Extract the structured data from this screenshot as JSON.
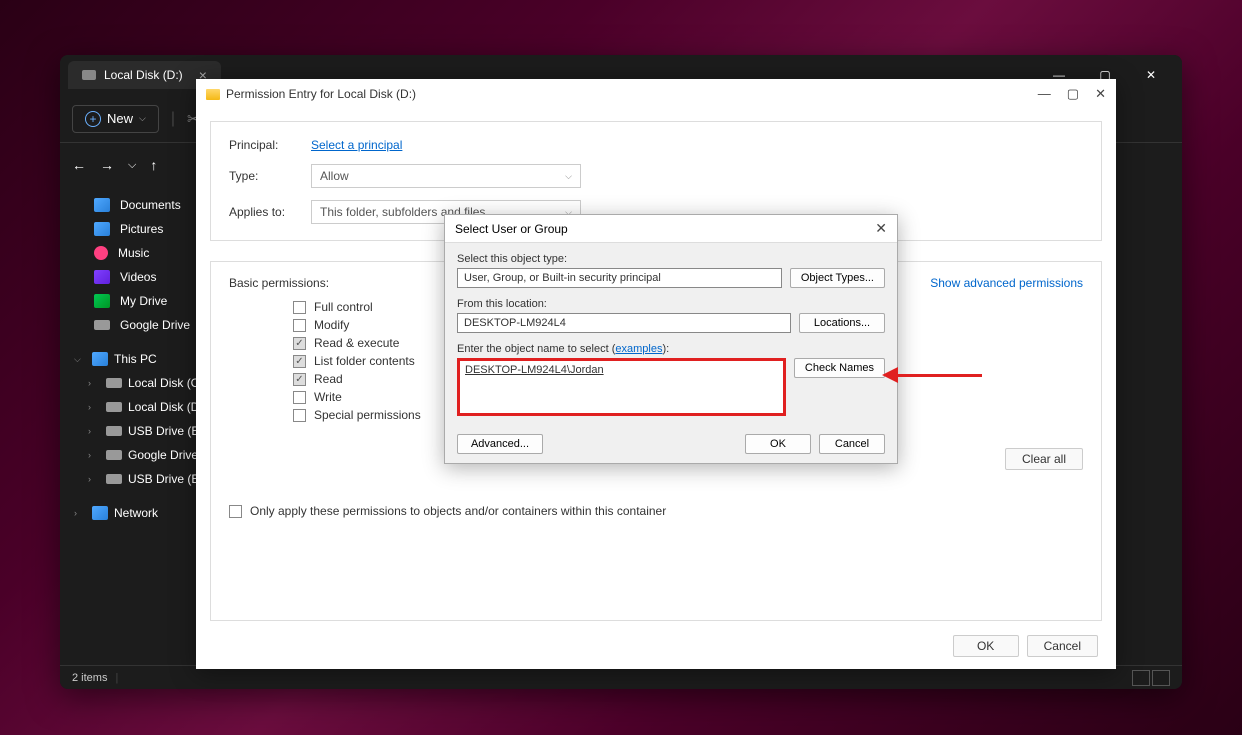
{
  "explorer": {
    "tab_title": "Local Disk (D:)",
    "new_btn": "New",
    "sidebar": {
      "quick": [
        {
          "label": "Documents",
          "icon": "ic-doc"
        },
        {
          "label": "Pictures",
          "icon": "ic-pic"
        },
        {
          "label": "Music",
          "icon": "ic-mus"
        },
        {
          "label": "Videos",
          "icon": "ic-vid"
        },
        {
          "label": "My Drive",
          "icon": "ic-drv"
        },
        {
          "label": "Google Drive",
          "icon": "ic-disk"
        }
      ],
      "this_pc": "This PC",
      "drives": [
        {
          "label": "Local Disk (C:)"
        },
        {
          "label": "Local Disk (D:)"
        },
        {
          "label": "USB Drive (E:)"
        },
        {
          "label": "Google Drive ("
        },
        {
          "label": "USB Drive (E:)"
        }
      ],
      "network": "Network"
    },
    "status": "2 items"
  },
  "perm": {
    "title": "Permission Entry for Local Disk (D:)",
    "principal_label": "Principal:",
    "principal_link": "Select a principal",
    "type_label": "Type:",
    "type_value": "Allow",
    "applies_label": "Applies to:",
    "applies_value": "This folder, subfolders and files",
    "basic_heading": "Basic permissions:",
    "perms": [
      {
        "label": "Full control",
        "checked": false
      },
      {
        "label": "Modify",
        "checked": false
      },
      {
        "label": "Read & execute",
        "checked": true
      },
      {
        "label": "List folder contents",
        "checked": true
      },
      {
        "label": "Read",
        "checked": true
      },
      {
        "label": "Write",
        "checked": false
      },
      {
        "label": "Special permissions",
        "checked": false
      }
    ],
    "adv_link": "Show advanced permissions",
    "only_apply": "Only apply these permissions to objects and/or containers within this container",
    "clear_btn": "Clear all",
    "ok_btn": "OK",
    "cancel_btn": "Cancel"
  },
  "user": {
    "title": "Select User or Group",
    "obj_type_label": "Select this object type:",
    "obj_type_value": "User, Group, or Built-in security principal",
    "obj_types_btn": "Object Types...",
    "loc_label": "From this location:",
    "loc_value": "DESKTOP-LM924L4",
    "loc_btn": "Locations...",
    "name_label": "Enter the object name to select",
    "examples_link": "examples",
    "name_value": "DESKTOP-LM924L4\\Jordan",
    "check_btn": "Check Names",
    "advanced_btn": "Advanced...",
    "ok_btn": "OK",
    "cancel_btn": "Cancel"
  }
}
